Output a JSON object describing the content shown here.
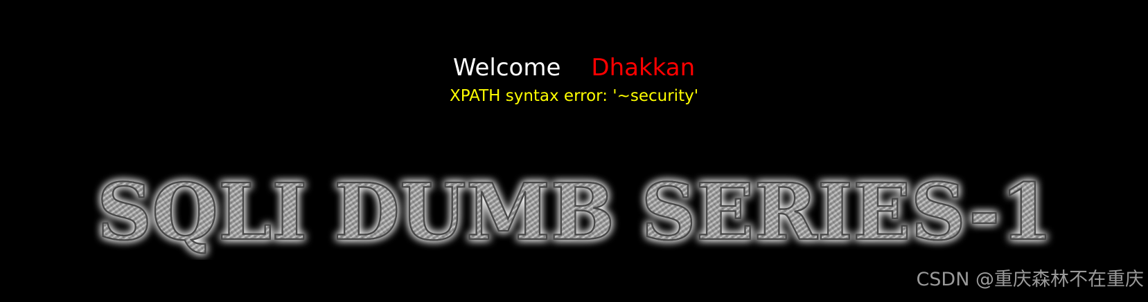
{
  "welcome": {
    "greeting": "Welcome",
    "username": "Dhakkan"
  },
  "error_message": "XPATH syntax error: '~security'",
  "banner": {
    "text": "SQLI DUMB SERIES-1"
  },
  "watermark": "CSDN @重庆森林不在重庆",
  "colors": {
    "background": "#000000",
    "greeting": "#ffffff",
    "username": "#ff0000",
    "error": "#ffff00",
    "banner_metal": "#8c8c8c",
    "banner_glow": "#ffffff",
    "watermark": "#9a9a9a"
  }
}
